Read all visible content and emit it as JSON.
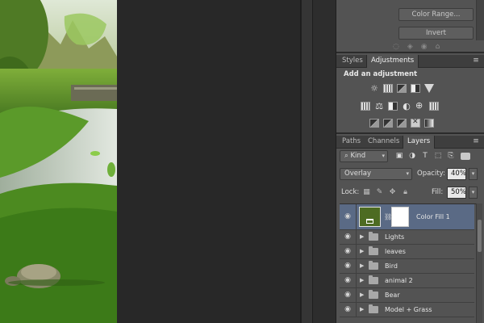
{
  "properties": {
    "color_range_label": "Color Range...",
    "invert_label": "Invert"
  },
  "top_tabs": [
    {
      "label": "Styles",
      "active": false
    },
    {
      "label": "Adjustments",
      "active": true
    }
  ],
  "adjustments": {
    "title": "Add an adjustment",
    "row1_icons": [
      "brightness-contrast-icon",
      "levels-icon",
      "curves-icon",
      "exposure-icon",
      "vibrance-icon"
    ],
    "row2_icons": [
      "hue-saturation-icon",
      "color-balance-icon",
      "black-white-icon",
      "photo-filter-icon",
      "channel-mixer-icon",
      "color-lookup-icon"
    ],
    "row3_icons": [
      "invert-icon",
      "posterize-icon",
      "threshold-icon",
      "selective-color-icon",
      "gradient-map-icon"
    ]
  },
  "layer_tabs": [
    {
      "label": "Paths",
      "active": false
    },
    {
      "label": "Channels",
      "active": false
    },
    {
      "label": "Layers",
      "active": true
    }
  ],
  "layers_panel": {
    "filter_kind": "Kind",
    "blend_mode": "Overlay",
    "opacity_label": "Opacity:",
    "opacity_value": "40%",
    "lock_label": "Lock:",
    "fill_label": "Fill:",
    "fill_value": "50%"
  },
  "layers": [
    {
      "name": "Color Fill 1",
      "type": "fill",
      "selected": true
    },
    {
      "name": "Lights",
      "type": "group",
      "selected": false
    },
    {
      "name": "leaves",
      "type": "group",
      "selected": false
    },
    {
      "name": "Bird",
      "type": "group",
      "selected": false
    },
    {
      "name": "animal 2",
      "type": "group",
      "selected": false
    },
    {
      "name": "Bear",
      "type": "group",
      "selected": false
    },
    {
      "name": "Model + Grass",
      "type": "group",
      "selected": false
    }
  ],
  "colors": {
    "fill_swatch": "#4d6b22",
    "selected_row": "#5a6a85",
    "panel_bg": "#535353"
  }
}
